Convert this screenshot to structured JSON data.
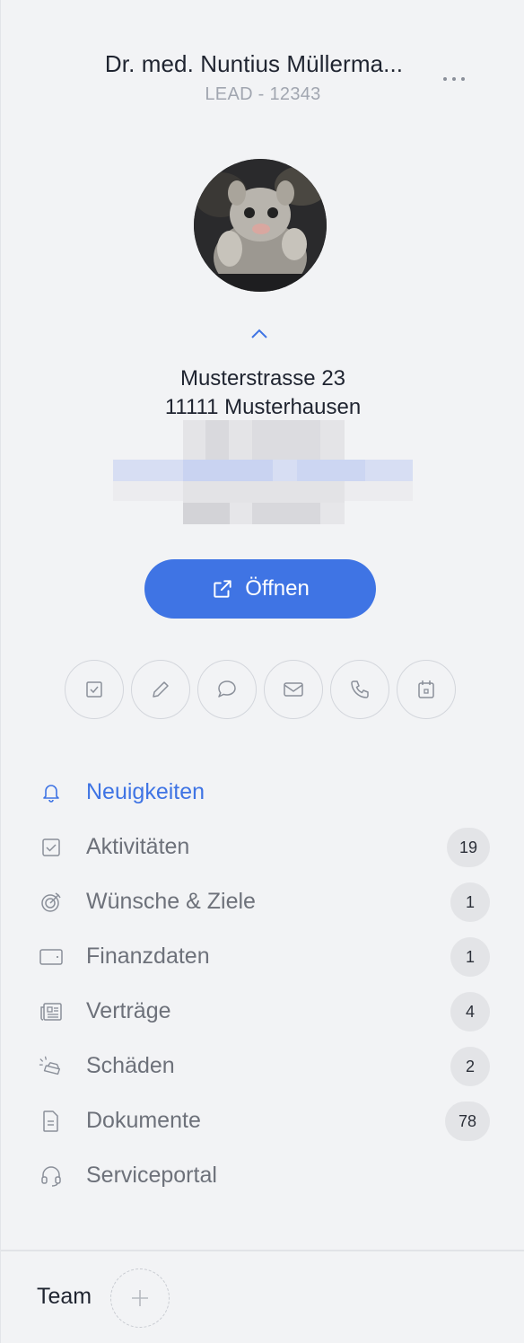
{
  "header": {
    "name": "Dr. med. Nuntius Müllerma...",
    "subtitle": "LEAD - 12343",
    "more_icon": "more-horizontal-icon"
  },
  "contact": {
    "street": "Musterstrasse 23",
    "city": "11111 Musterhausen"
  },
  "open_button": {
    "label": "Öffnen",
    "icon": "external-link-icon"
  },
  "actions": [
    {
      "name": "task",
      "icon": "checkbox-icon"
    },
    {
      "name": "edit",
      "icon": "pencil-icon"
    },
    {
      "name": "chat",
      "icon": "chat-bubble-icon"
    },
    {
      "name": "email",
      "icon": "envelope-icon"
    },
    {
      "name": "phone",
      "icon": "phone-icon"
    },
    {
      "name": "calendar",
      "icon": "calendar-icon"
    }
  ],
  "nav": {
    "items": [
      {
        "label": "Neuigkeiten",
        "icon": "bell-icon",
        "badge": ""
      },
      {
        "label": "Aktivitäten",
        "icon": "checkbox-icon",
        "badge": "19"
      },
      {
        "label": "Wünsche & Ziele",
        "icon": "target-icon",
        "badge": "1"
      },
      {
        "label": "Finanzdaten",
        "icon": "wallet-icon",
        "badge": "1"
      },
      {
        "label": "Verträge",
        "icon": "contract-icon",
        "badge": "4"
      },
      {
        "label": "Schäden",
        "icon": "car-crash-icon",
        "badge": "2"
      },
      {
        "label": "Dokumente",
        "icon": "document-icon",
        "badge": "78"
      },
      {
        "label": "Serviceportal",
        "icon": "headset-icon",
        "badge": ""
      }
    ]
  },
  "team": {
    "label": "Team",
    "add_icon": "plus-icon"
  },
  "colors": {
    "accent": "#3f74e4",
    "background": "#f2f3f5",
    "badge": "#e3e4e7"
  }
}
